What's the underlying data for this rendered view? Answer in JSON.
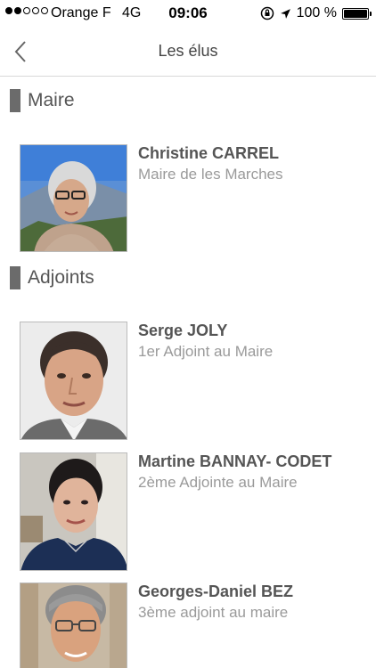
{
  "status_bar": {
    "carrier": "Orange F",
    "network": "4G",
    "time": "09:06",
    "battery": "100 %"
  },
  "nav": {
    "title": "Les élus"
  },
  "sections": {
    "maire": {
      "label": "Maire",
      "people": [
        {
          "name": "Christine CARREL",
          "role": "Maire de les Marches"
        }
      ]
    },
    "adjoints": {
      "label": "Adjoints",
      "people": [
        {
          "name": "Serge JOLY",
          "role": "1er Adjoint au Maire"
        },
        {
          "name": "Martine BANNAY- CODET",
          "role": "2ème Adjointe au Maire"
        },
        {
          "name": "Georges-Daniel BEZ",
          "role": "3ème adjoint au maire"
        }
      ]
    }
  }
}
